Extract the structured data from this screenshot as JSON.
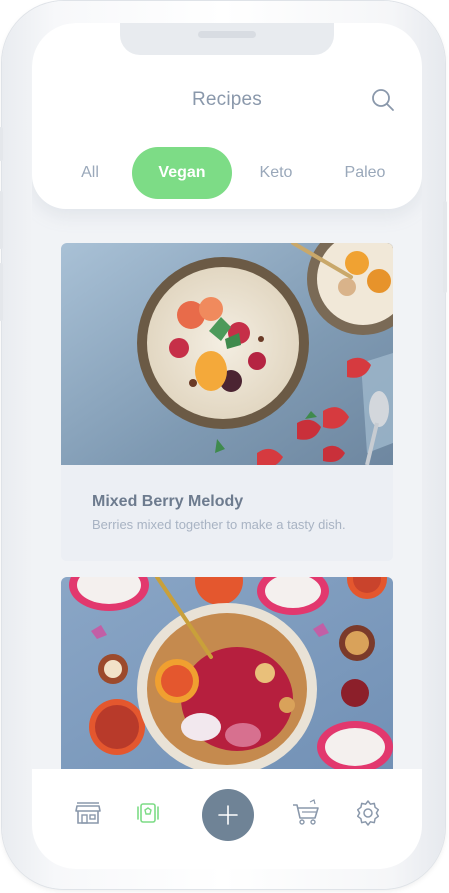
{
  "header": {
    "title": "Recipes",
    "search_icon": "search-icon"
  },
  "tabs": [
    {
      "label": "All",
      "active": false
    },
    {
      "label": "Vegan",
      "active": true
    },
    {
      "label": "Keto",
      "active": false
    },
    {
      "label": "Paleo",
      "active": false
    }
  ],
  "recipes": [
    {
      "title": "Mixed Berry Melody",
      "description": "Berries mixed together to make a tasty dish."
    },
    {
      "title": "",
      "description": ""
    }
  ],
  "bottom_nav": {
    "items": [
      {
        "icon": "storefront-icon",
        "active": false
      },
      {
        "icon": "recipe-card-icon",
        "active": true
      },
      {
        "icon": "plus-icon",
        "active": false
      },
      {
        "icon": "shopping-cart-icon",
        "active": false
      },
      {
        "icon": "gear-icon",
        "active": false
      }
    ]
  },
  "colors": {
    "accent_green": "#7ddc86",
    "fab": "#6f8396",
    "text_muted": "#8a98ab"
  }
}
